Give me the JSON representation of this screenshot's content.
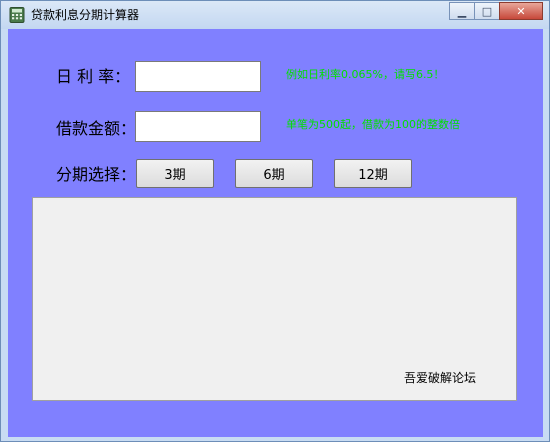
{
  "window": {
    "title": "贷款利息分期计算器",
    "minimize_icon": "minimize-icon",
    "maximize_icon": "maximize-icon",
    "close_icon": "close-icon",
    "minimize_glyph": "▁",
    "maximize_glyph": "□",
    "close_glyph": "✕"
  },
  "form": {
    "daily_rate_label": "日 利 率：",
    "daily_rate_value": "",
    "daily_rate_hint": "例如日利率0.065%，请写6.5！",
    "amount_label": "借款金额：",
    "amount_value": "",
    "amount_hint": "单笔为500起，借款为100的整数倍",
    "period_label": "分期选择：",
    "period_buttons": [
      "3期",
      "6期",
      "12期"
    ]
  },
  "output": {
    "text": "吾爱破解论坛",
    "grip": "⁄⁄"
  },
  "colors": {
    "background": "#8080ff",
    "hint": "#00e000"
  }
}
